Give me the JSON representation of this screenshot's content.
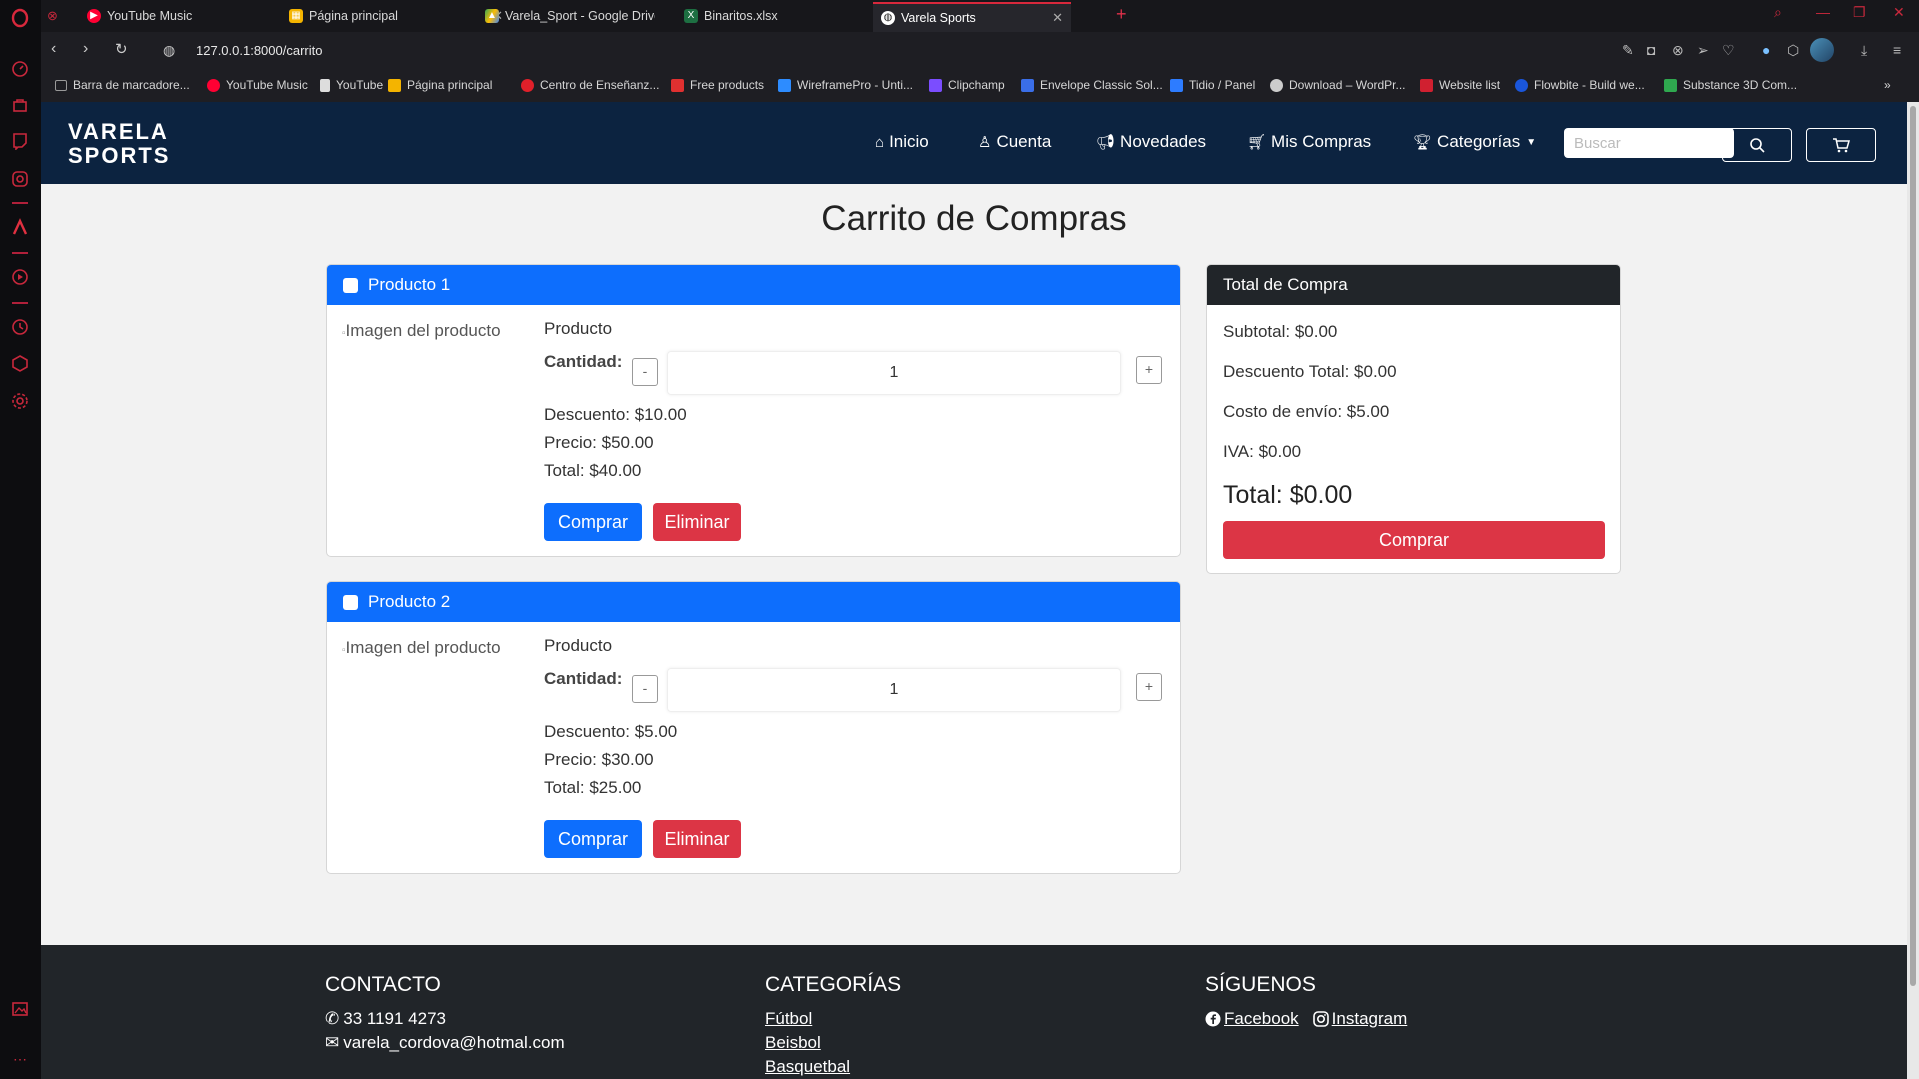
{
  "tabs": [
    {
      "title": "YouTube Music",
      "fav_color": "#ff0033"
    },
    {
      "title": "Página principal",
      "fav_color": "#f4b400"
    },
    {
      "title": "Varela_Sport - Google Drive",
      "fav_color": "#34a853"
    },
    {
      "title": "Binaritos.xlsx",
      "fav_color": "#1d6f42"
    },
    {
      "title": "Varela Sports",
      "fav_color": "#ffffff"
    }
  ],
  "address": {
    "url": "127.0.0.1:8000/carrito"
  },
  "bookmarks": [
    {
      "label": "Barra de marcadore...",
      "color": "#888888"
    },
    {
      "label": "YouTube Music",
      "color": "#ff0033"
    },
    {
      "label": "YouTube",
      "color": "#dddddd"
    },
    {
      "label": "Página principal",
      "color": "#f4b400"
    },
    {
      "label": "Centro de Enseñanz...",
      "color": "#e0202a"
    },
    {
      "label": "Free products",
      "color": "#e03030"
    },
    {
      "label": "WireframePro - Unti...",
      "color": "#2d8cff"
    },
    {
      "label": "Clipchamp",
      "color": "#7b4dff"
    },
    {
      "label": "Envelope Classic Sol...",
      "color": "#3a6ee8"
    },
    {
      "label": "Tidio / Panel",
      "color": "#2d7cff"
    },
    {
      "label": "Download – WordPr...",
      "color": "#cccccc"
    },
    {
      "label": "Website list",
      "color": "#d02030"
    },
    {
      "label": "Flowbite - Build we...",
      "color": "#1a56db"
    },
    {
      "label": "Substance 3D Com...",
      "color": "#2fa84f"
    }
  ],
  "navbar": {
    "brand_line1": "VARELA",
    "brand_line2": "SPORTS",
    "links": [
      "Inicio",
      "Cuenta",
      "Novedades",
      "Mis Compras",
      "Categorías"
    ],
    "search_placeholder": "Buscar"
  },
  "cart": {
    "title": "Carrito de Compras",
    "items": [
      {
        "header": "Producto 1",
        "img_alt": "Imagen del producto",
        "name": "Producto",
        "qty_label": "Cantidad:",
        "qty": "1",
        "discount": "Descuento: $10.00",
        "price": "Precio: $50.00",
        "total": "Total: $40.00",
        "buy": "Comprar",
        "delete": "Eliminar"
      },
      {
        "header": "Producto 2",
        "img_alt": "Imagen del producto",
        "name": "Producto",
        "qty_label": "Cantidad:",
        "qty": "1",
        "discount": "Descuento: $5.00",
        "price": "Precio: $30.00",
        "total": "Total: $25.00",
        "buy": "Comprar",
        "delete": "Eliminar"
      }
    ]
  },
  "summary": {
    "title": "Total de Compra",
    "subtotal": "Subtotal: $0.00",
    "discount": "Descuento Total: $0.00",
    "shipping": "Costo de envío: $5.00",
    "iva": "IVA: $0.00",
    "total": "Total: $0.00",
    "buy": "Comprar"
  },
  "footer": {
    "contact_title": "CONTACTO",
    "phone": "33 1191 4273",
    "email": "varela_cordova@hotmal.com",
    "categories_title": "CATEGORÍAS",
    "categories": [
      "Fútbol",
      "Beisbol",
      "Basquetbal"
    ],
    "follow_title": "SÍGUENOS",
    "facebook": "Facebook",
    "instagram": "Instagram"
  },
  "colors": {
    "navbar": "#0c2340",
    "primary": "#0d6efd",
    "danger": "#dc3545",
    "dark": "#212529",
    "opera_red": "#c8283c"
  }
}
